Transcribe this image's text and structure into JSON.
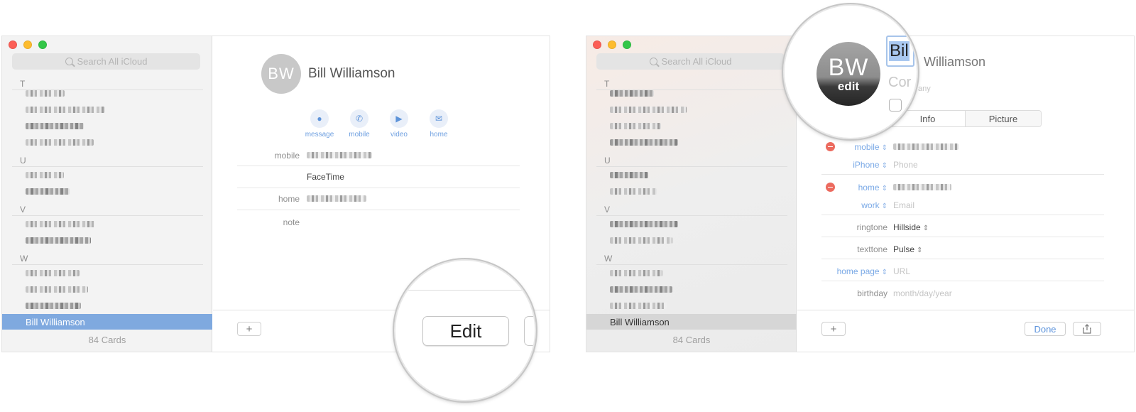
{
  "left_panel": {
    "search_placeholder": "Search All iCloud",
    "sections": [
      "T",
      "U",
      "V",
      "W"
    ],
    "selected_contact": "Bill Williamson",
    "card_count": "84 Cards",
    "contact": {
      "initials": "BW",
      "name": "Bill Williamson",
      "actions": [
        {
          "label": "message",
          "icon": "message-icon"
        },
        {
          "label": "mobile",
          "icon": "phone-icon"
        },
        {
          "label": "video",
          "icon": "video-icon"
        },
        {
          "label": "home",
          "icon": "mail-icon"
        }
      ],
      "fields": [
        {
          "label": "mobile",
          "value": ""
        },
        {
          "label": "",
          "value": "FaceTime"
        },
        {
          "label": "home",
          "value": ""
        },
        {
          "label": "note",
          "value": ""
        }
      ]
    },
    "add_button": "+",
    "edit_button": "Edit"
  },
  "right_panel": {
    "search_placeholder": "Search All iCloud",
    "sections": [
      "T",
      "U",
      "V",
      "W"
    ],
    "selected_contact": "Bill Williamson",
    "card_count": "84 Cards",
    "avatar": {
      "initials": "BW",
      "edit_label": "edit"
    },
    "first_name_fragment": "Bil",
    "last_name": "Williamson",
    "company_placeholder_fragment": "Cor",
    "company_placeholder_tail": "any",
    "tabs": [
      "Info",
      "Picture"
    ],
    "edit_fields": [
      {
        "label": "mobile",
        "value": "",
        "placeholder": "",
        "removable": true,
        "blue": true
      },
      {
        "label": "iPhone",
        "value": "",
        "placeholder": "Phone",
        "removable": false,
        "blue": true
      },
      {
        "label": "home",
        "value": "",
        "placeholder": "",
        "removable": true,
        "blue": true
      },
      {
        "label": "work",
        "value": "",
        "placeholder": "Email",
        "removable": false,
        "blue": true
      },
      {
        "label": "ringtone",
        "value": "Hillside",
        "placeholder": "",
        "removable": false,
        "blue": false
      },
      {
        "label": "texttone",
        "value": "Pulse",
        "placeholder": "",
        "removable": false,
        "blue": false
      },
      {
        "label": "home page",
        "value": "",
        "placeholder": "URL",
        "removable": false,
        "blue": true
      },
      {
        "label": "birthday",
        "value": "",
        "placeholder": "month/day/year",
        "removable": false,
        "blue": false
      }
    ],
    "add_button": "+",
    "done_button": "Done",
    "share_icon": "share-icon"
  },
  "colors": {
    "selection_blue": "#7fa9df",
    "accent_blue": "#6d9fe0",
    "remove_red": "#ec6a5e"
  }
}
